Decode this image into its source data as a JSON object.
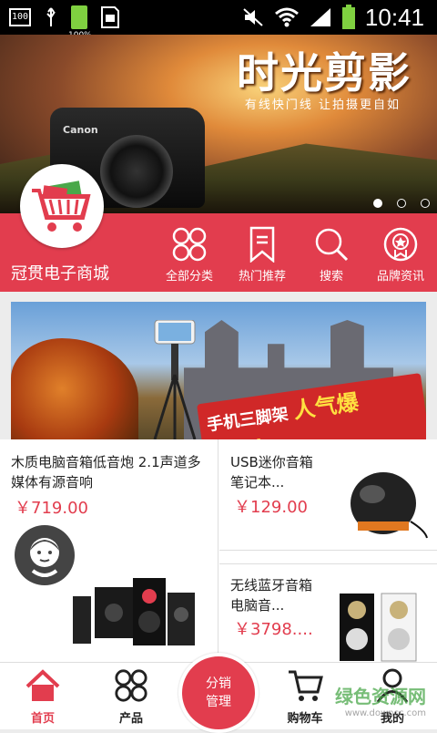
{
  "status_bar": {
    "left_badge": "100",
    "battery_small_percent": "100%",
    "time": "10:41"
  },
  "banner": {
    "title": "时光剪影",
    "subtitle": "有线快门线  让拍摄更自如",
    "camera_brand": "Canon",
    "slide_count": 3,
    "active_slide": 1
  },
  "shop": {
    "name": "冠贯电子商城"
  },
  "nav": [
    {
      "label": "全部分类",
      "icon": "grid-icon"
    },
    {
      "label": "热门推荐",
      "icon": "bookmark-icon"
    },
    {
      "label": "搜索",
      "icon": "search-icon"
    },
    {
      "label": "品牌资讯",
      "icon": "badge-icon"
    }
  ],
  "promo": {
    "tag_small": "手机三脚架",
    "tag_big": "人气爆款！！"
  },
  "products": [
    {
      "name": "木质电脑音箱低音炮 2.1声道多媒体有源音响",
      "price": "￥719.00"
    },
    {
      "name": "USB迷你音箱 笔记本...",
      "price": "￥129.00"
    },
    {
      "name": "无线蓝牙音箱 电脑音...",
      "price": "￥3798...."
    }
  ],
  "tabbar": {
    "home": "首页",
    "products": "产品",
    "center_line1": "分销",
    "center_line2": "管理",
    "cart": "购物车",
    "mine": "我的"
  },
  "watermark": {
    "text": "绿色资源网",
    "url": "www.downcc.com"
  },
  "colors": {
    "brand_red": "#e23d4e",
    "watermark_green": "#4aa84a"
  }
}
